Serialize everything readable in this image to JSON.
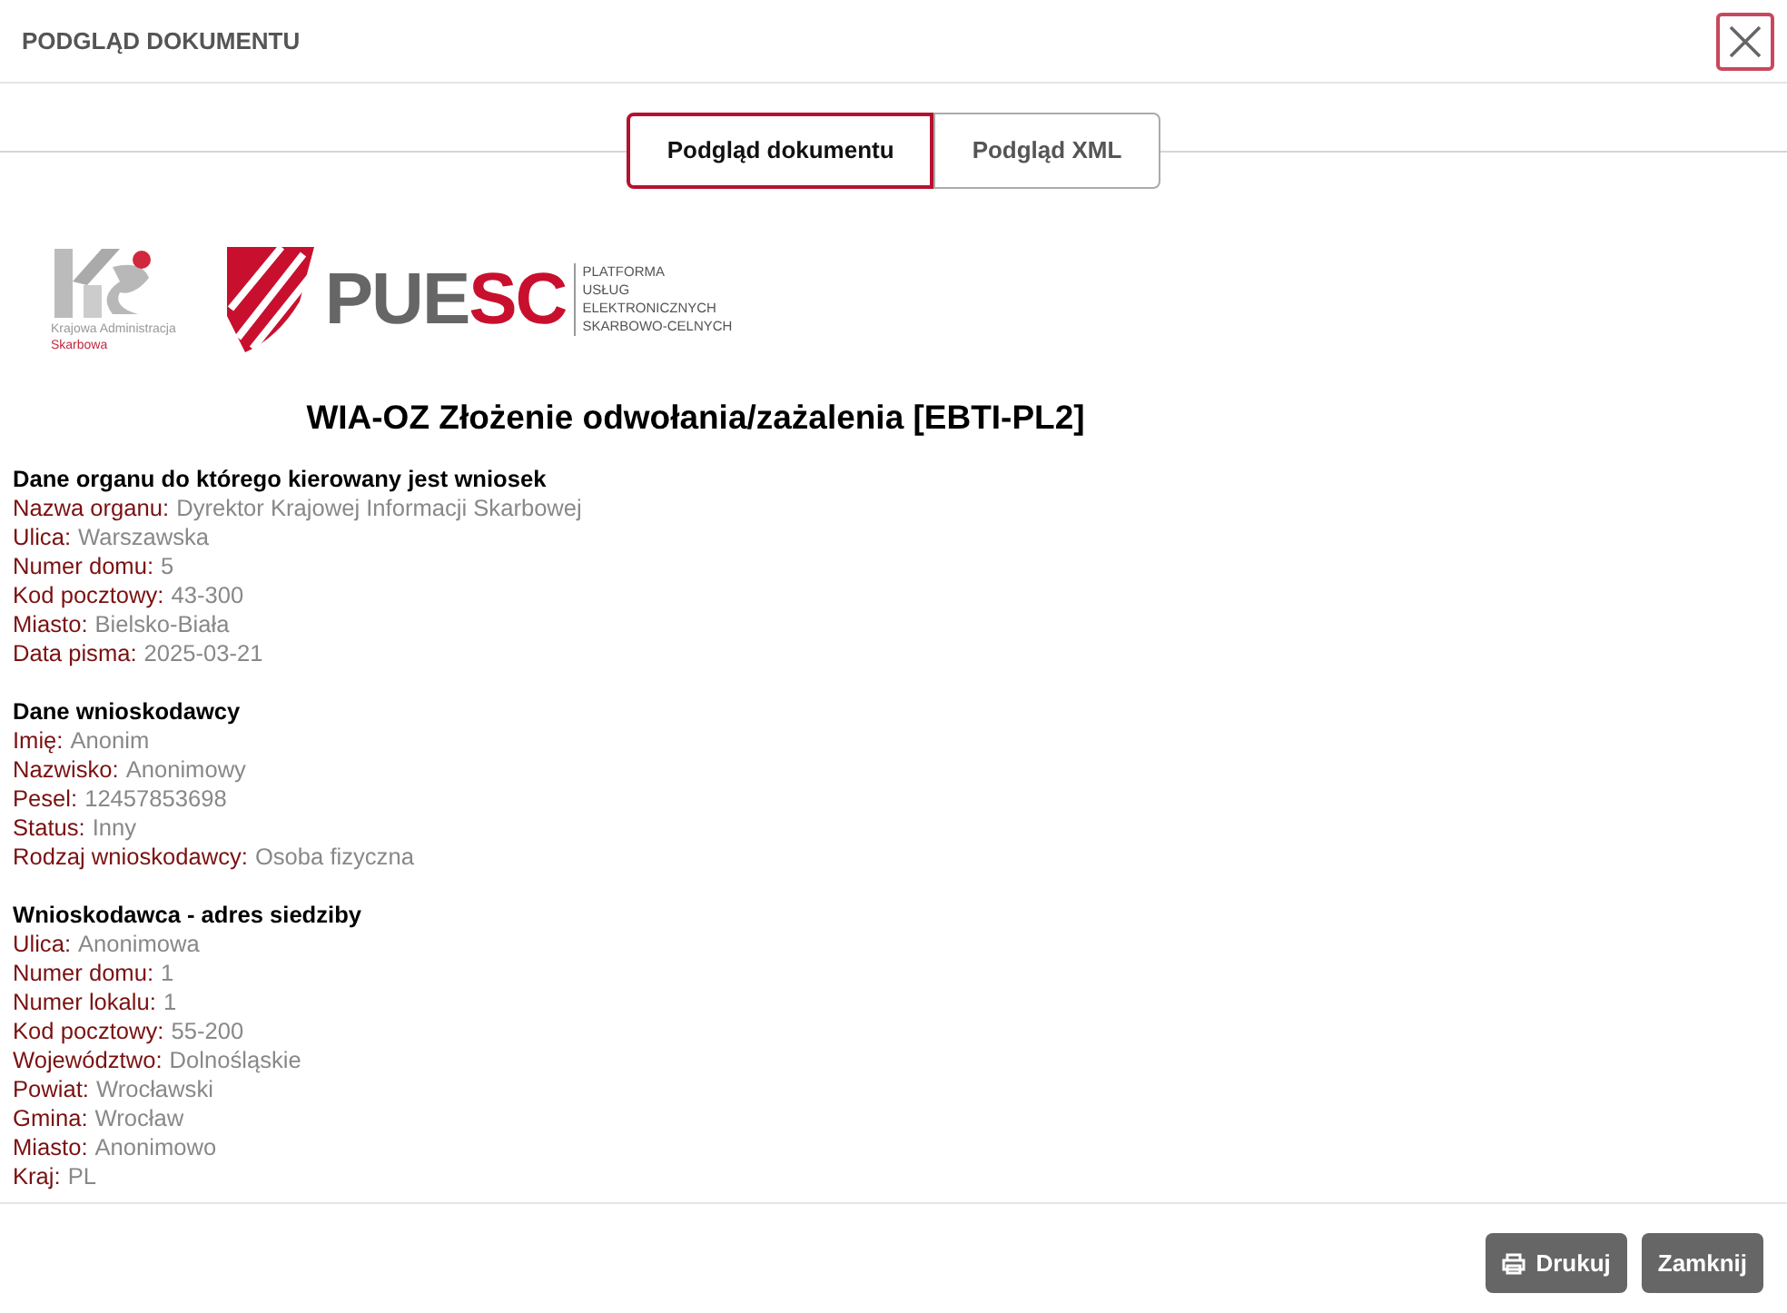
{
  "dialog": {
    "title": "PODGLĄD DOKUMENTU"
  },
  "tabs": [
    {
      "label": "Podgląd dokumentu",
      "selected": true
    },
    {
      "label": "Podgląd XML",
      "selected": false
    }
  ],
  "logos": {
    "kas_caption": [
      "Krajowa Administracja",
      "Skarbowa"
    ],
    "puesc_name": "PUESC",
    "puesc_caption": [
      "PLATFORMA",
      "USŁUG",
      "ELEKTRONICZNYCH",
      "SKARBOWO-CELNYCH"
    ]
  },
  "document": {
    "title": "WIA-OZ Złożenie odwołania/zażalenia [EBTI-PL2]",
    "sections": [
      {
        "heading": "Dane organu do którego kierowany jest wniosek",
        "fields": [
          {
            "label": "Nazwa organu:",
            "value": "Dyrektor Krajowej Informacji Skarbowej"
          },
          {
            "label": "Ulica:",
            "value": "Warszawska"
          },
          {
            "label": "Numer domu:",
            "value": "5"
          },
          {
            "label": "Kod pocztowy:",
            "value": "43-300"
          },
          {
            "label": "Miasto:",
            "value": "Bielsko-Biała"
          },
          {
            "label": "Data pisma:",
            "value": "2025-03-21"
          }
        ]
      },
      {
        "heading": "Dane wnioskodawcy",
        "fields": [
          {
            "label": "Imię:",
            "value": "Anonim"
          },
          {
            "label": "Nazwisko:",
            "value": "Anonimowy"
          },
          {
            "label": "Pesel:",
            "value": "12457853698"
          },
          {
            "label": "Status:",
            "value": "Inny"
          },
          {
            "label": "Rodzaj wnioskodawcy:",
            "value": "Osoba fizyczna"
          }
        ]
      },
      {
        "heading": "Wnioskodawca - adres siedziby",
        "fields": [
          {
            "label": "Ulica:",
            "value": "Anonimowa"
          },
          {
            "label": "Numer domu:",
            "value": "1"
          },
          {
            "label": "Numer lokalu:",
            "value": "1"
          },
          {
            "label": "Kod pocztowy:",
            "value": "55-200"
          },
          {
            "label": "Województwo:",
            "value": "Dolnośląskie"
          },
          {
            "label": "Powiat:",
            "value": "Wrocławski"
          },
          {
            "label": "Gmina:",
            "value": "Wrocław"
          },
          {
            "label": "Miasto:",
            "value": "Anonimowo"
          },
          {
            "label": "Kraj:",
            "value": "PL"
          }
        ]
      }
    ]
  },
  "buttons": [
    {
      "label": "Drukuj",
      "kind": "print"
    },
    {
      "label": "Zamknij",
      "kind": "plain"
    }
  ]
}
